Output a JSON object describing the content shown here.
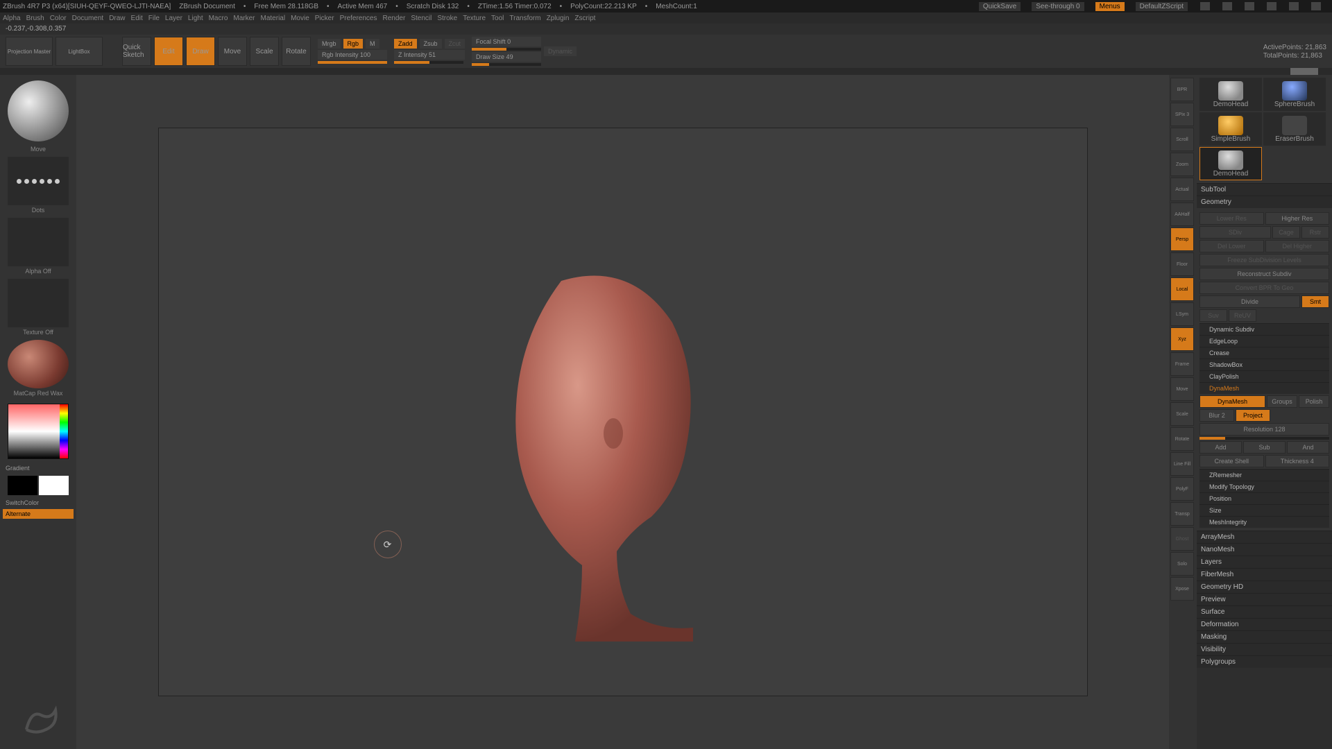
{
  "titlebar": {
    "app": "ZBrush 4R7 P3 (x64)[SIUH-QEYF-QWEO-LJTI-NAEA]",
    "doc": "ZBrush Document",
    "freemem": "Free Mem 28.118GB",
    "activemem": "Active Mem 467",
    "scratch": "Scratch Disk 132",
    "ztime": "ZTime:1.56 Timer:0.072",
    "poly": "PolyCount:22.213 KP",
    "mesh": "MeshCount:1",
    "quicksave": "QuickSave",
    "seethrough": "See-through   0",
    "menus": "Menus",
    "script": "DefaultZScript"
  },
  "menubar": [
    "Alpha",
    "Brush",
    "Color",
    "Document",
    "Draw",
    "Edit",
    "File",
    "Layer",
    "Light",
    "Macro",
    "Marker",
    "Material",
    "Movie",
    "Picker",
    "Preferences",
    "Render",
    "Stencil",
    "Stroke",
    "Texture",
    "Tool",
    "Transform",
    "Zplugin",
    "Zscript"
  ],
  "coords": "-0.237,-0.308,0.357",
  "toolbar": {
    "projection": "Projection Master",
    "lightbox": "LightBox",
    "quicksketch": "Quick Sketch",
    "edit": "Edit",
    "draw": "Draw",
    "move": "Move",
    "scale": "Scale",
    "rotate": "Rotate",
    "mrgb": "Mrgb",
    "rgb": "Rgb",
    "m": "M",
    "rgbint": "Rgb Intensity 100",
    "zadd": "Zadd",
    "zsub": "Zsub",
    "zcut": "Zcut",
    "zint": "Z Intensity 51",
    "focal": "Focal Shift 0",
    "drawsize": "Draw Size 49",
    "dynamic": "Dynamic",
    "active": "ActivePoints: 21,863",
    "total": "TotalPoints: 21,863"
  },
  "left": {
    "brush": "Move",
    "stroke": "Dots",
    "alpha": "Alpha Off",
    "texture": "Texture Off",
    "material": "MatCap Red Wax",
    "gradient": "Gradient",
    "switch": "SwitchColor",
    "alternate": "Alternate"
  },
  "rightstrip": {
    "bpr": "BPR",
    "spix": "SPix 3",
    "scroll": "Scroll",
    "zoom": "Zoom",
    "actual": "Actual",
    "aahalf": "AAHalf",
    "persp": "Persp",
    "floor": "Floor",
    "local": "Local",
    "lsym": "LSym",
    "xyz": "Xyz",
    "frame": "Frame",
    "move": "Move",
    "scale": "Scale",
    "rotate": "Rotate",
    "linefill": "Line Fill",
    "polyf": "PolyF",
    "transp": "Transp",
    "ghost": "Ghost",
    "solo": "Solo",
    "xpose": "Xpose"
  },
  "tools": {
    "t1": "DemoHead",
    "t2": "SphereBrush",
    "t3": "SimpleBrush",
    "t4": "EraserBrush",
    "t5": "DemoHead"
  },
  "panel": {
    "subtool": "SubTool",
    "geometry": "Geometry",
    "lowerres": "Lower Res",
    "higherres": "Higher Res",
    "sdiv": "SDiv",
    "cage": "Cage",
    "rstr": "Rstr",
    "dellower": "Del Lower",
    "delhigher": "Del Higher",
    "freeze": "Freeze SubDivision Levels",
    "reconstruct": "Reconstruct Subdiv",
    "convert": "Convert BPR To Geo",
    "divide": "Divide",
    "smt": "Smt",
    "suv": "Suv",
    "resv": "ReUV",
    "dynsubdiv": "Dynamic Subdiv",
    "edgeloop": "EdgeLoop",
    "crease": "Crease",
    "shadowbox": "ShadowBox",
    "claypolish": "ClayPolish",
    "dynamesh": "DynaMesh",
    "dynameshbtn": "DynaMesh",
    "groups": "Groups",
    "polish": "Polish",
    "blur": "Blur 2",
    "project": "Project",
    "resolution": "Resolution 128",
    "add": "Add",
    "sub": "Sub",
    "and": "And",
    "createshell": "Create Shell",
    "thickness": "Thickness 4",
    "zremesher": "ZRemesher",
    "modtopo": "Modify Topology",
    "position": "Position",
    "size": "Size",
    "meshint": "MeshIntegrity",
    "arraymesh": "ArrayMesh",
    "nanomesh": "NanoMesh",
    "layers": "Layers",
    "fibermesh": "FiberMesh",
    "geohd": "Geometry HD",
    "preview": "Preview",
    "surface": "Surface",
    "deformation": "Deformation",
    "masking": "Masking",
    "visibility": "Visibility",
    "polygroups": "Polygroups"
  }
}
